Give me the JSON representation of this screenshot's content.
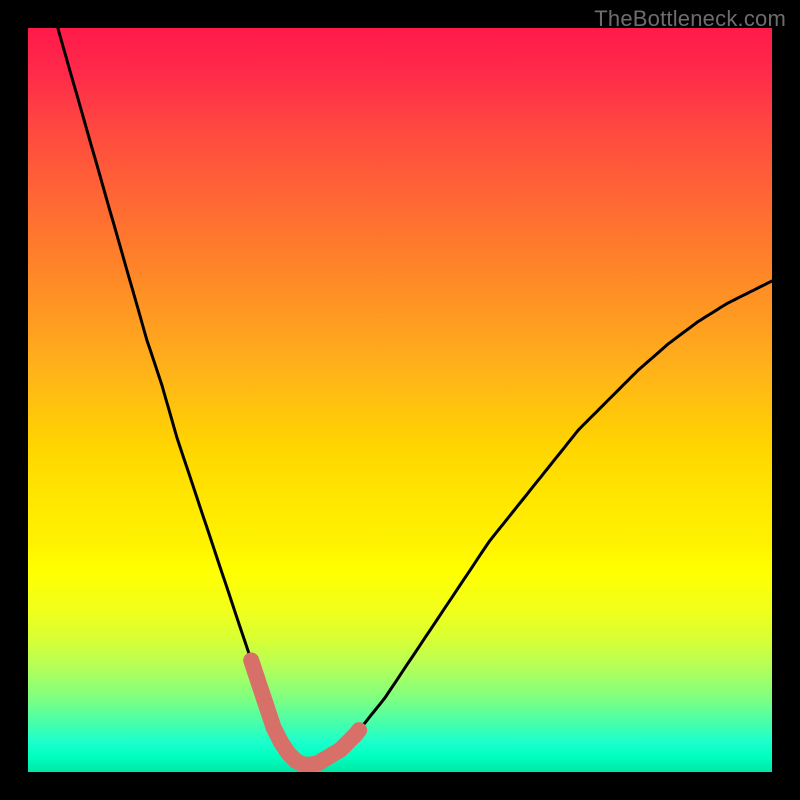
{
  "watermark": "TheBottleneck.com",
  "chart_data": {
    "type": "line",
    "title": "",
    "xlabel": "",
    "ylabel": "",
    "xlim": [
      0,
      100
    ],
    "ylim": [
      0,
      100
    ],
    "grid": false,
    "legend": false,
    "series": [
      {
        "name": "bottleneck-curve",
        "x": [
          4,
          6,
          8,
          10,
          12,
          14,
          16,
          18,
          20,
          22,
          24,
          26,
          28,
          30,
          31,
          32,
          33,
          34,
          35,
          36,
          37,
          38,
          39,
          40,
          42,
          44,
          46,
          48,
          50,
          54,
          58,
          62,
          66,
          70,
          74,
          78,
          82,
          86,
          90,
          94,
          98,
          100
        ],
        "values": [
          100,
          93,
          86,
          79,
          72,
          65,
          58,
          52,
          45,
          39,
          33,
          27,
          21,
          15,
          12,
          9,
          6,
          4,
          2.5,
          1.5,
          1,
          1,
          1.2,
          1.8,
          3,
          5,
          7.5,
          10,
          13,
          19,
          25,
          31,
          36,
          41,
          46,
          50,
          54,
          57.5,
          60.5,
          63,
          65,
          66
        ]
      }
    ],
    "annotations": [
      {
        "name": "marker-left",
        "x_range": [
          30,
          34
        ],
        "note": "highlighted segment"
      },
      {
        "name": "marker-bottom",
        "x_range": [
          34,
          40
        ],
        "note": "highlighted segment"
      },
      {
        "name": "marker-right",
        "x_range": [
          40,
          44.5
        ],
        "note": "highlighted segment"
      }
    ],
    "background_gradient": {
      "direction": "vertical",
      "stops": [
        {
          "pos": 0.0,
          "color": "#ff1a4a"
        },
        {
          "pos": 0.5,
          "color": "#ffd400"
        },
        {
          "pos": 0.73,
          "color": "#ffff00"
        },
        {
          "pos": 1.0,
          "color": "#00e6a6"
        }
      ]
    }
  }
}
